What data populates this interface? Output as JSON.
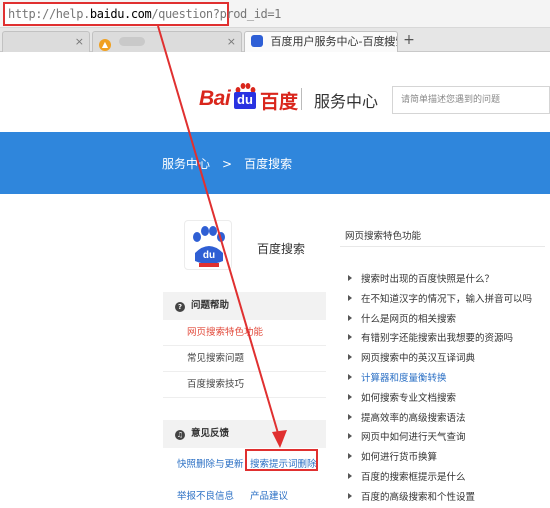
{
  "browser": {
    "url_prefix": "http://help.",
    "url_domain": "baidu.com",
    "url_path": "/question?prod_id=1",
    "tabs": [
      {
        "label": "",
        "close": "×"
      },
      {
        "label": "",
        "close": "×"
      },
      {
        "label": "百度用户服务中心-百度搜索",
        "close": "×"
      }
    ],
    "new_tab": "+"
  },
  "header": {
    "logo_latin": "Bai",
    "logo_du": "du",
    "logo_cn": "百度",
    "service_center": "服务中心",
    "search_placeholder": "请简单描述您遇到的问题"
  },
  "breadcrumb": {
    "home": "服务中心",
    "sep": ">",
    "current": "百度搜索"
  },
  "product": {
    "name": "百度搜索",
    "icon_text": "du"
  },
  "left_panel": {
    "help_section": {
      "icon": "?",
      "title": "问题帮助",
      "items": [
        "网页搜索特色功能",
        "常见搜索问题",
        "百度搜索技巧"
      ]
    },
    "feedback_section": {
      "icon": "♫",
      "title": "意见反馈",
      "links": [
        "快照删除与更新",
        "搜索提示词删除",
        "举报不良信息",
        "产品建议"
      ]
    }
  },
  "right_panel": {
    "title": "网页搜索特色功能",
    "items": [
      "搜索时出现的百度快照是什么？",
      "在不知道汉字的情况下，输入拼音可以吗",
      "什么是网页的相关搜索",
      "有错别字还能搜索出我想要的资源吗",
      "网页搜索中的英汉互译词典",
      "计算器和度量衡转换",
      "如何搜索专业文档搜索",
      "提高效率的高级搜索语法",
      "网页中如何进行天气查询",
      "如何进行货币换算",
      "百度的搜索框提示是什么",
      "百度的高级搜索和个性设置"
    ]
  },
  "colors": {
    "banner": "#2f86dc",
    "annotation_red": "#e03030",
    "link_blue": "#2a6fc4",
    "active_red": "#e24a3b"
  }
}
